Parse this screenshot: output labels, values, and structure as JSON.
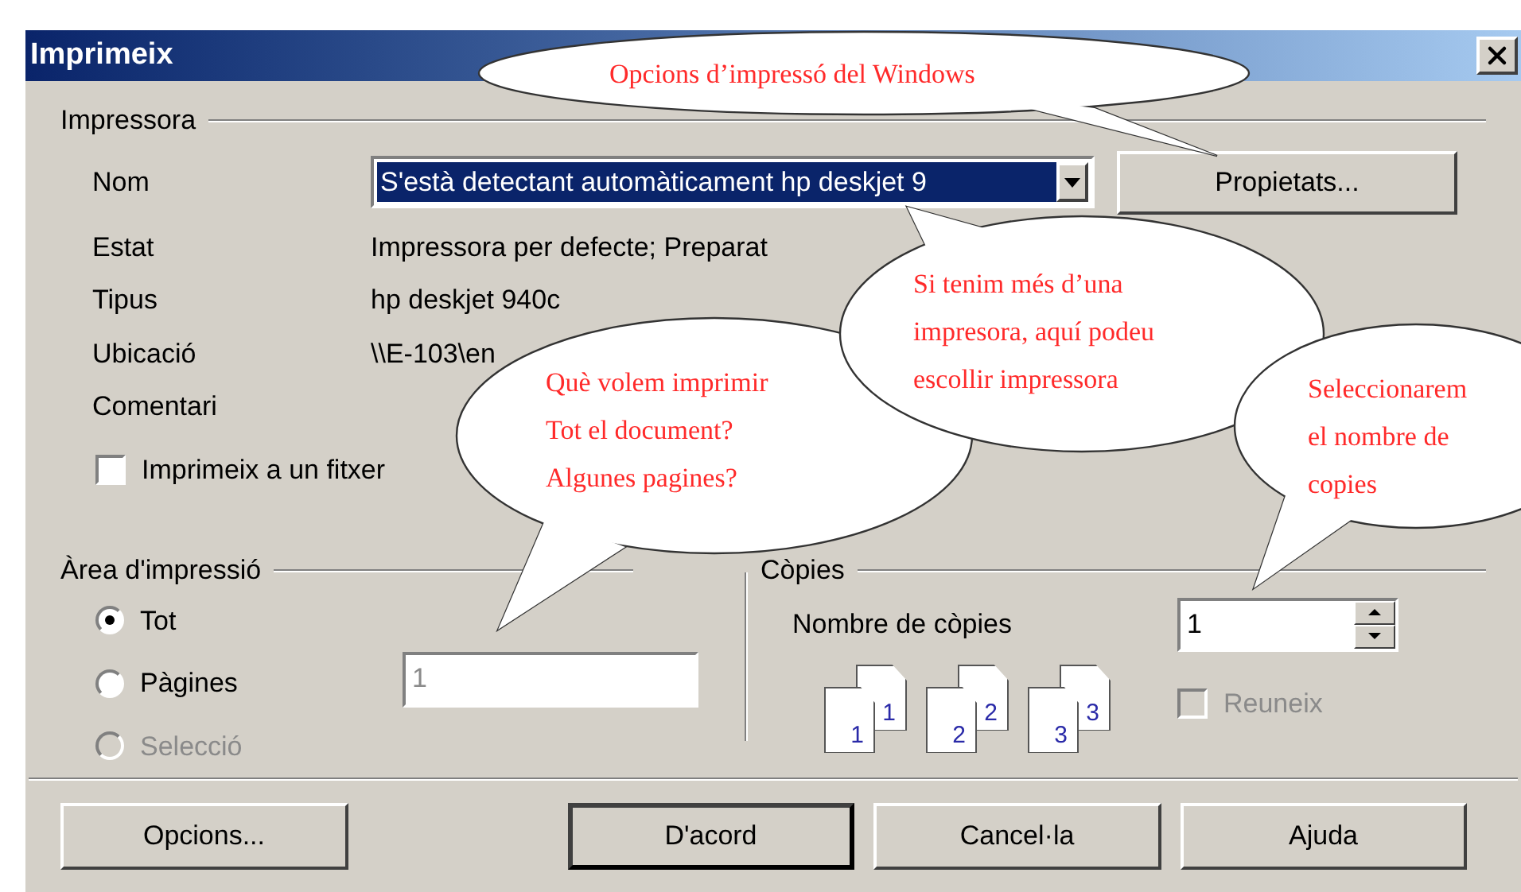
{
  "window": {
    "title": "Imprimeix"
  },
  "printer": {
    "group_label": "Impressora",
    "name_label": "Nom",
    "name_value": "S'està detectant automàticament hp deskjet 9",
    "properties_button": "Propietats...",
    "info": [
      {
        "label": "Estat",
        "value": "Impressora per defecte; Preparat"
      },
      {
        "label": "Tipus",
        "value": "hp deskjet 940c"
      },
      {
        "label": "Ubicació",
        "value": "\\\\E-103\\en"
      },
      {
        "label": "Comentari"
      }
    ],
    "print_to_file": {
      "label": "Imprimeix a un fitxer",
      "checked": false
    }
  },
  "print_range": {
    "group_label": "Àrea d'impressió",
    "options": [
      {
        "label": "Tot",
        "selected": true,
        "disabled": false
      },
      {
        "label": "Pàgines",
        "selected": false,
        "disabled": false
      },
      {
        "label": "Selecció",
        "selected": false,
        "disabled": true
      }
    ],
    "pages_field": {
      "value": "1"
    }
  },
  "copies": {
    "group_label": "Còpies",
    "count_label": "Nombre de còpies",
    "count_value": "1",
    "collate_icons": [
      {
        "back": "1",
        "front": "1"
      },
      {
        "back": "2",
        "front": "2"
      },
      {
        "back": "3",
        "front": "3"
      }
    ],
    "collate": {
      "label": "Reuneix",
      "checked": false,
      "disabled": true
    }
  },
  "buttons": [
    {
      "label": "Opcions...",
      "default": false
    },
    {
      "label": "D'acord",
      "default": true
    },
    {
      "label": "Cancel·la",
      "default": false
    },
    {
      "label": "Ajuda",
      "default": false
    }
  ],
  "callouts": [
    {
      "lines": [
        "Opcions d’impressó del Windows"
      ]
    },
    {
      "lines": [
        "Què volem imprimir",
        "Tot el document?",
        "Algunes pagines?"
      ]
    },
    {
      "lines": [
        "Si tenim més d’una",
        "impresora, aquí podeu",
        "escollir impressora"
      ]
    },
    {
      "lines": [
        "Seleccionarem",
        "el nombre de",
        "copies"
      ]
    }
  ]
}
